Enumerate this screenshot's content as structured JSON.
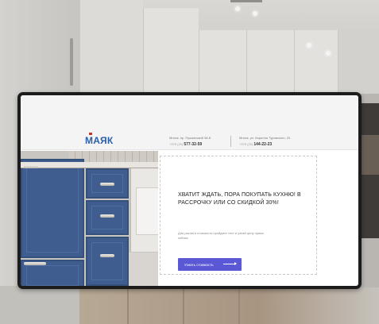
{
  "header": {
    "logo": {
      "text_main": "МАЯК",
      "accent_color": "#c8332b",
      "brand_color": "#2c5fa8"
    },
    "contacts": [
      {
        "address": "Минск, пр. Пушкинский 38-Б",
        "phone_prefix": "+375 (29)",
        "phone_number": "577-32-59"
      },
      {
        "address": "Минск, ул. Кирилла Туровского, 23",
        "phone_prefix": "+375 (29)",
        "phone_number": "144-22-23"
      }
    ]
  },
  "hero": {
    "title": "ХВАТИТ ЖДАТЬ, ПОРА ПОКУПАТЬ КУХНЮ! В РАССРОЧКУ ИЛИ СО СКИДКОЙ 30%!",
    "text": "Для расчета стоимости пройдите тест и узнай цену прямо сейчас",
    "cta_label": "Узнать стоимость",
    "cta_color": "#5b58d6",
    "image_icon": "kitchen-photo"
  }
}
